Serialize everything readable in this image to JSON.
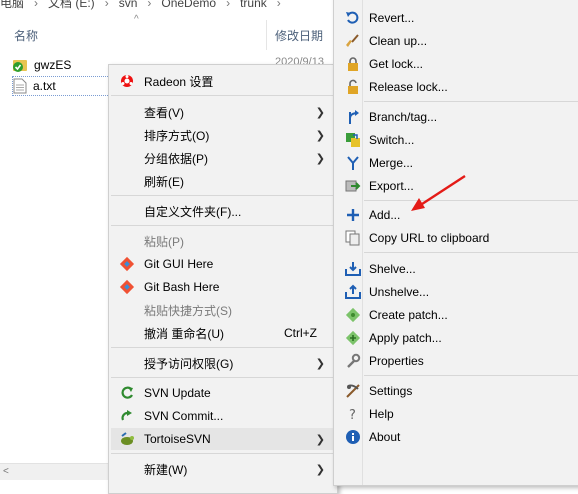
{
  "explorer": {
    "breadcrumb": [
      "电脑",
      "文档 (E:)",
      "svn",
      "OneDemo",
      "trunk"
    ],
    "columns": {
      "name": "名称",
      "date": "修改日期"
    },
    "files": [
      {
        "name": "gwzES",
        "date": "2020/9/13",
        "icon": "svn-folder-icon"
      },
      {
        "name": "a.txt",
        "date": "",
        "icon": "text-file-icon"
      }
    ]
  },
  "context_menu": {
    "items": [
      {
        "label": "Radeon 设置",
        "icon": "radeon-icon"
      },
      {
        "label": "查看(V)",
        "submenu": true
      },
      {
        "label": "排序方式(O)",
        "submenu": true
      },
      {
        "label": "分组依据(P)",
        "submenu": true
      },
      {
        "label": "刷新(E)"
      },
      {
        "label": "自定义文件夹(F)..."
      },
      {
        "label": "粘贴(P)",
        "disabled": true
      },
      {
        "label": "Git GUI Here",
        "icon": "git-icon"
      },
      {
        "label": "Git Bash Here",
        "icon": "git-icon"
      },
      {
        "label": "粘贴快捷方式(S)",
        "disabled": true
      },
      {
        "label": "撤消 重命名(U)",
        "shortcut": "Ctrl+Z"
      },
      {
        "label": "授予访问权限(G)",
        "submenu": true
      },
      {
        "label": "SVN Update",
        "icon": "svn-update-icon"
      },
      {
        "label": "SVN Commit...",
        "icon": "svn-commit-icon"
      },
      {
        "label": "TortoiseSVN",
        "icon": "tortoise-icon",
        "submenu": true
      },
      {
        "label": "新建(W)",
        "submenu": true
      }
    ]
  },
  "svn_menu": {
    "items": [
      {
        "label": "Revert...",
        "icon": "revert-icon"
      },
      {
        "label": "Clean up...",
        "icon": "broom-icon"
      },
      {
        "label": "Get lock...",
        "icon": "lock-icon"
      },
      {
        "label": "Release lock...",
        "icon": "unlock-icon"
      },
      {
        "label": "Branch/tag...",
        "icon": "branch-icon"
      },
      {
        "label": "Switch...",
        "icon": "switch-icon"
      },
      {
        "label": "Merge...",
        "icon": "merge-icon"
      },
      {
        "label": "Export...",
        "icon": "export-icon"
      },
      {
        "label": "Add...",
        "icon": "plus-icon"
      },
      {
        "label": "Copy URL to clipboard",
        "icon": "copy-icon"
      },
      {
        "label": "Shelve...",
        "icon": "shelve-icon"
      },
      {
        "label": "Unshelve...",
        "icon": "unshelve-icon"
      },
      {
        "label": "Create patch...",
        "icon": "patch-icon"
      },
      {
        "label": "Apply patch...",
        "icon": "apply-patch-icon"
      },
      {
        "label": "Properties",
        "icon": "wrench-icon"
      },
      {
        "label": "Settings",
        "icon": "settings-icon"
      },
      {
        "label": "Help",
        "icon": "help-icon"
      },
      {
        "label": "About",
        "icon": "info-icon"
      }
    ]
  },
  "colors": {
    "annotation_arrow": "#e41b17",
    "menu_bg": "#f2f2f2",
    "highlight": "#e5e5e5"
  }
}
